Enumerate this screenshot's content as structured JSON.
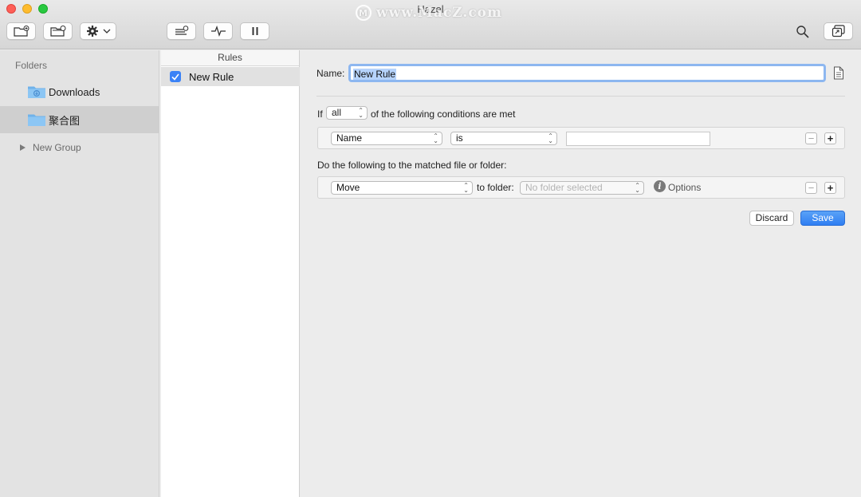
{
  "window": {
    "title": "Hazel",
    "watermark": "www.MacZ.com"
  },
  "toolbar": {
    "buttons": [
      "new-folder",
      "folder-action",
      "settings-menu",
      "rule-list",
      "activity",
      "pause"
    ],
    "right_buttons": [
      "search",
      "preview"
    ]
  },
  "sidebar": {
    "heading": "Folders",
    "items": [
      {
        "label": "Downloads",
        "icon": "downloads-folder-icon",
        "selected": false
      },
      {
        "label": "聚合图",
        "icon": "folder-icon",
        "selected": true
      }
    ],
    "group": {
      "label": "New Group",
      "expanded": false
    }
  },
  "rules": {
    "header": "Rules",
    "items": [
      {
        "label": "New Rule",
        "checked": true
      }
    ]
  },
  "editor": {
    "name_label": "Name:",
    "name_value": "New Rule",
    "conditions": {
      "if_label": "If",
      "match_value": "all",
      "suffix": "of the following conditions are met",
      "rows": [
        {
          "attribute": "Name",
          "operator": "is",
          "value": ""
        }
      ]
    },
    "actions": {
      "label": "Do the following to the matched file or folder:",
      "rows": [
        {
          "action": "Move",
          "to_label": "to folder:",
          "folder_placeholder": "No folder selected",
          "options_label": "Options"
        }
      ]
    },
    "buttons": {
      "discard": "Discard",
      "save": "Save"
    }
  },
  "colors": {
    "accent": "#3b82f6",
    "selection": "#b6d3fb",
    "sidebar_bg": "#e3e3e3"
  }
}
